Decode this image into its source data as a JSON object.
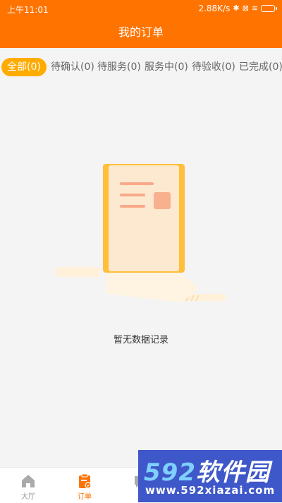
{
  "statusbar": {
    "time": "上午11:01",
    "speed": "2.88K/s"
  },
  "header": {
    "title": "我的订单"
  },
  "tabs": [
    {
      "label": "全部(0)",
      "active": true
    },
    {
      "label": "待确认(0)"
    },
    {
      "label": "待服务(0)"
    },
    {
      "label": "服务中(0)"
    },
    {
      "label": "待验收(0)"
    },
    {
      "label": "已完成(0)"
    }
  ],
  "empty_state": {
    "message": "暂无数据记录"
  },
  "bottom_nav": [
    {
      "label": "大厅",
      "icon": "home-icon"
    },
    {
      "label": "订单",
      "icon": "order-icon",
      "active": true
    },
    {
      "label": "",
      "icon": "message-icon"
    },
    {
      "label": "",
      "icon": "user-icon"
    },
    {
      "label": "",
      "icon": "more-icon"
    }
  ],
  "watermark": {
    "brand_num": "592",
    "brand_text": "软件园",
    "url": "www.592xiazai.com"
  },
  "colors": {
    "primary": "#ff7300",
    "tab_active": "#ffab00",
    "watermark": "#3f58c9"
  }
}
